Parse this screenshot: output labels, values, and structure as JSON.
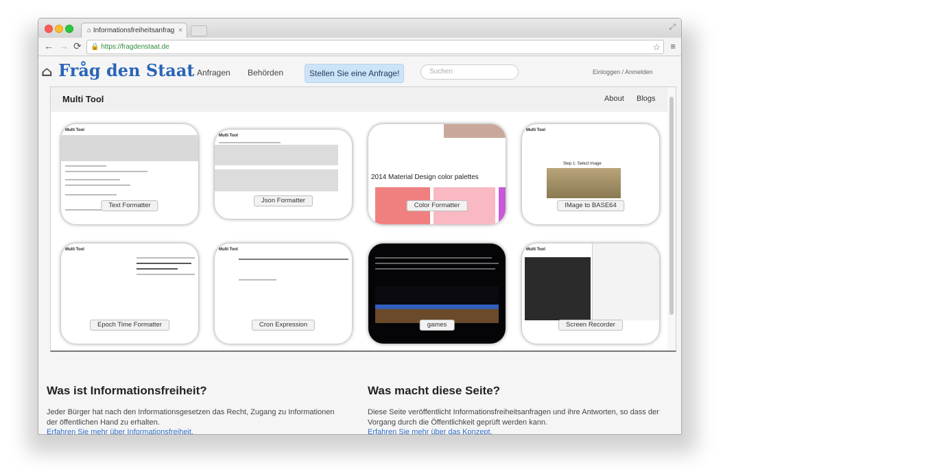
{
  "browser": {
    "tab_title": "Informationsfreiheitsanfrag",
    "tab_close": "×",
    "url": "https://fragdenstaat.de"
  },
  "site": {
    "logo": "Fråg den Staat",
    "nav": [
      "Anfragen",
      "Behörden"
    ],
    "cta": "Stellen Sie eine Anfrage!",
    "search_placeholder": "Suchen",
    "login": "Einloggen / Anmelden"
  },
  "embed": {
    "title": "Multi Tool",
    "links": [
      "About",
      "Blogs"
    ],
    "cards": [
      {
        "label": "Text Formatter",
        "mini": "Multi Tool"
      },
      {
        "label": "Json Formatter",
        "mini": "Multi Tool"
      },
      {
        "label": "Color Formatter",
        "mini": "2014 Material Design color palettes"
      },
      {
        "label": "IMage to BASE64",
        "mini": "Multi Tool",
        "caption": "Step 1: Select Image"
      },
      {
        "label": "Epoch Time Formatter",
        "mini": "Multi Tool"
      },
      {
        "label": "Cron Expression",
        "mini": "Multi Tool"
      },
      {
        "label": "games",
        "mini": ""
      },
      {
        "label": "Screen Recorder",
        "mini": "Multi Tool"
      }
    ]
  },
  "info": [
    {
      "heading": "Was ist Informationsfreiheit?",
      "text": "Jeder Bürger hat nach den Informationsgesetzen das Recht, Zugang zu Informationen der öffentlichen Hand zu erhalten.",
      "link": "Erfahren Sie mehr über Informationsfreiheit."
    },
    {
      "heading": "Was macht diese Seite?",
      "text": "Diese Seite veröffentlicht Informationsfreiheitsanfragen und ihre Antworten, so dass der Vorgang durch die Öffentlichkeit geprüft werden kann.",
      "link": "Erfahren Sie mehr über das Konzept."
    }
  ],
  "colors": {
    "brand_blue": "#2a64b8",
    "cta_bg": "#cde3f7",
    "link": "#2f6fc8",
    "url_green": "#2f8a3a"
  }
}
